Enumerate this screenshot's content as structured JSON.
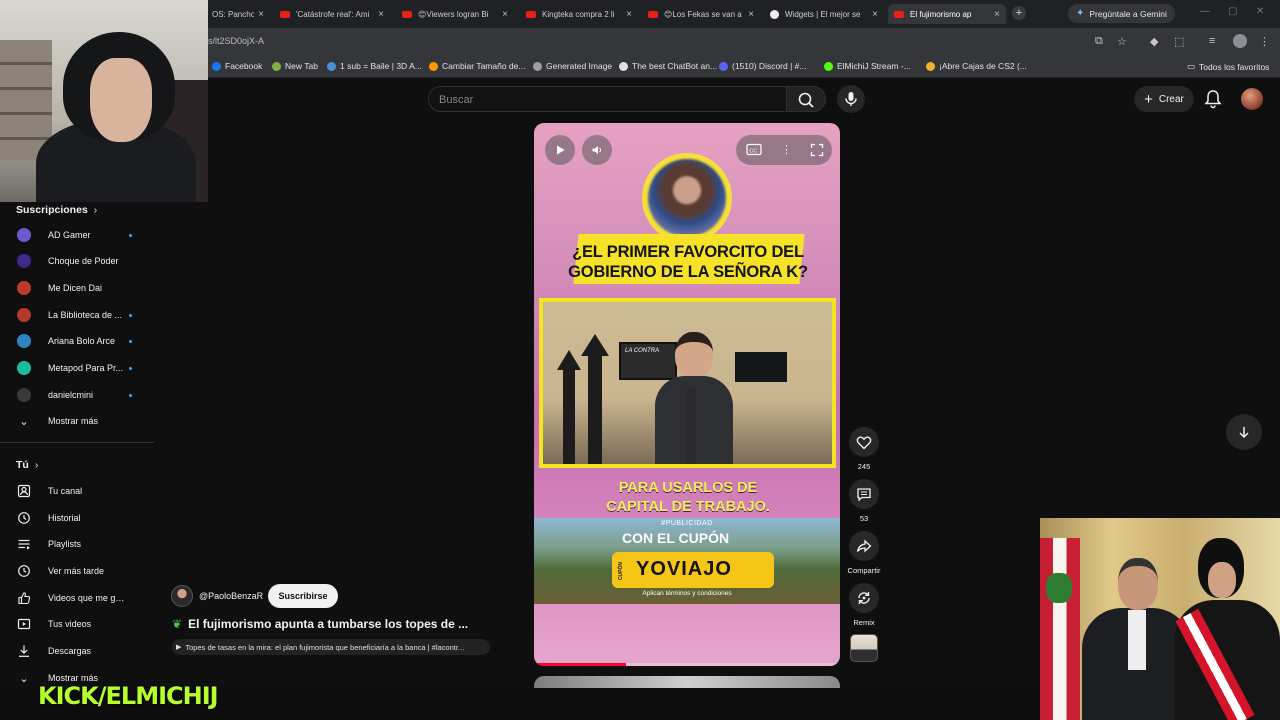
{
  "browser": {
    "tabs": [
      {
        "label": "OS: Pancho",
        "favicon": "generic-favicon"
      },
      {
        "label": "'Catástrofe real': Ami",
        "favicon": "youtube-favicon"
      },
      {
        "label": "😊Viewers logran Bi",
        "favicon": "youtube-favicon"
      },
      {
        "label": "Kingteka compra 2 li",
        "favicon": "youtube-favicon"
      },
      {
        "label": "😊Los Fekas se van a",
        "favicon": "youtube-favicon"
      },
      {
        "label": "Widgets | El mejor se",
        "favicon": "widget-favicon"
      },
      {
        "label": "El fujimorismo ap",
        "favicon": "youtube-favicon",
        "active": true
      }
    ],
    "gemini_label": "Pregúntale a Gemini",
    "url": "s/lt2SD0ojX-A",
    "bookmarks": [
      {
        "label": "Facebook",
        "color": "#1877f2"
      },
      {
        "label": "New Tab",
        "color": "#7cb342"
      },
      {
        "label": "1 sub = Baile | 3D A...",
        "color": "#4a90d9"
      },
      {
        "label": "Cambiar Tamaño de...",
        "color": "#ff9800"
      },
      {
        "label": "Generated Image",
        "color": "#9e9e9e"
      },
      {
        "label": "The best ChatBot an...",
        "color": "#e0e0e0"
      },
      {
        "label": "(1510) Discord | #...",
        "color": "#5865f2"
      },
      {
        "label": "ElMichiJ Stream -...",
        "color": "#53fc18"
      },
      {
        "label": "¡Abre Cajas de CS2 (...",
        "color": "#f2b233"
      }
    ],
    "all_bookmarks": "Todos los favoritos"
  },
  "header": {
    "search_placeholder": "Buscar",
    "create_label": "Crear"
  },
  "sidebar": {
    "subscriptions_title": "Suscripciones",
    "subscriptions": [
      {
        "label": "AD Gamer",
        "color": "#6a5acd",
        "dot": true
      },
      {
        "label": "Choque de Poder",
        "color": "#3d2a8a",
        "dot": false
      },
      {
        "label": "Me Dicen Dai",
        "color": "#c0392b",
        "dot": false
      },
      {
        "label": "La Biblioteca de ...",
        "color": "#b03a2e",
        "dot": true
      },
      {
        "label": "Ariana Bolo Arce",
        "color": "#2e86c1",
        "dot": true
      },
      {
        "label": "Metapod Para Pr...",
        "color": "#1abc9c",
        "dot": true
      },
      {
        "label": "danielcmini",
        "color": "#3a3a3a",
        "dot": true
      }
    ],
    "show_more": "Mostrar más",
    "you_title": "Tú",
    "you_items": [
      {
        "label": "Tu canal",
        "icon": "channel-icon"
      },
      {
        "label": "Historial",
        "icon": "history-icon"
      },
      {
        "label": "Playlists",
        "icon": "playlists-icon"
      },
      {
        "label": "Ver más tarde",
        "icon": "watch-later-icon"
      },
      {
        "label": "Videos que me gus...",
        "icon": "liked-icon"
      },
      {
        "label": "Tus videos",
        "icon": "your-videos-icon"
      },
      {
        "label": "Descargas",
        "icon": "downloads-icon"
      }
    ],
    "show_more_2": "Mostrar más"
  },
  "short": {
    "headline_1": "¿EL PRIMER FAVORCITO DEL",
    "headline_2": "GOBIERNO DE LA SEÑORA K?",
    "screen_text": "LA CONTRA",
    "lower_1": "PARA USARLOS DE",
    "lower_2": "CAPITAL DE TRABAJO.",
    "ad_label": "#PUBLICIDAD",
    "ad_cupon": "CON EL CUPÓN",
    "ad_code": "YOVIAJO",
    "ad_side": "CUPÓN",
    "ad_terms": "Aplican términos y condiciones",
    "progress": 0.3,
    "likes": "245",
    "comments": "53",
    "share_label": "Compartir",
    "remix_label": "Remix"
  },
  "channel": {
    "handle": "@PaoloBenzaR",
    "subscribe_label": "Suscribirse",
    "title": "El fujimorismo apunta a tumbarse los topes de ...",
    "subtitle": "Topes de tasas en la mira: el plan fujimorista que beneficiaría a la banca | #lacontr..."
  },
  "overlay": {
    "kick_text": "KICK/ELMICHIJ"
  }
}
